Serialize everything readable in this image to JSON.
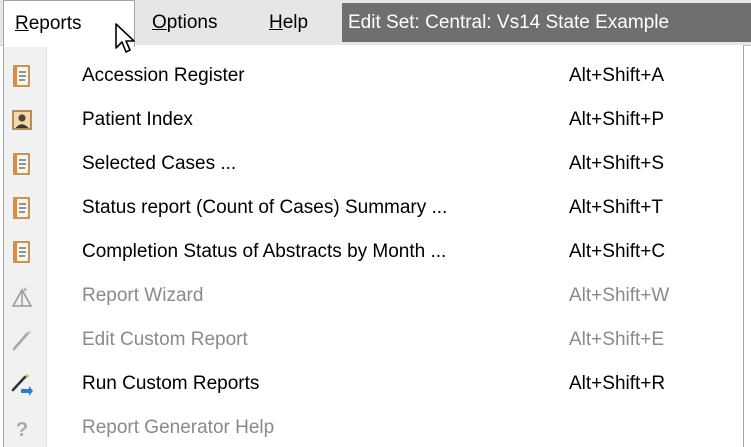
{
  "menubar": {
    "reports": {
      "accel": "R",
      "rest": "eports"
    },
    "options": {
      "accel": "O",
      "rest": "ptions"
    },
    "help": {
      "accel": "H",
      "rest": "elp"
    },
    "title": "Edit Set: Central: Vs14 State Example"
  },
  "menu": {
    "items": [
      {
        "icon": "report-document-icon",
        "label": "Accession Register",
        "shortcut": "Alt+Shift+A",
        "enabled": true
      },
      {
        "icon": "patient-card-icon",
        "label": "Patient Index",
        "shortcut": "Alt+Shift+P",
        "enabled": true
      },
      {
        "icon": "report-document-icon",
        "label": "Selected Cases ...",
        "shortcut": "Alt+Shift+S",
        "enabled": true
      },
      {
        "icon": "report-document-icon",
        "label": "Status report (Count of Cases) Summary ...",
        "shortcut": "Alt+Shift+T",
        "enabled": true
      },
      {
        "icon": "report-document-icon",
        "label": "Completion Status of Abstracts by Month ...",
        "shortcut": "Alt+Shift+C",
        "enabled": true
      },
      {
        "icon": "wizard-icon",
        "label": "Report Wizard",
        "shortcut": "Alt+Shift+W",
        "enabled": false
      },
      {
        "icon": "magic-wand-icon",
        "label": "Edit Custom Report",
        "shortcut": "Alt+Shift+E",
        "enabled": false
      },
      {
        "icon": "magic-wand-run-icon",
        "label": "Run Custom Reports",
        "shortcut": "Alt+Shift+R",
        "enabled": true
      },
      {
        "icon": "help-question-icon",
        "label": "Report Generator Help",
        "shortcut": "",
        "enabled": false
      }
    ]
  },
  "colors": {
    "menubar_bg": "#e6e6e6",
    "title_strip_bg": "#6f6f6f",
    "disabled_text": "#8a8a8a",
    "gutter_bg": "#f1f1f1"
  }
}
